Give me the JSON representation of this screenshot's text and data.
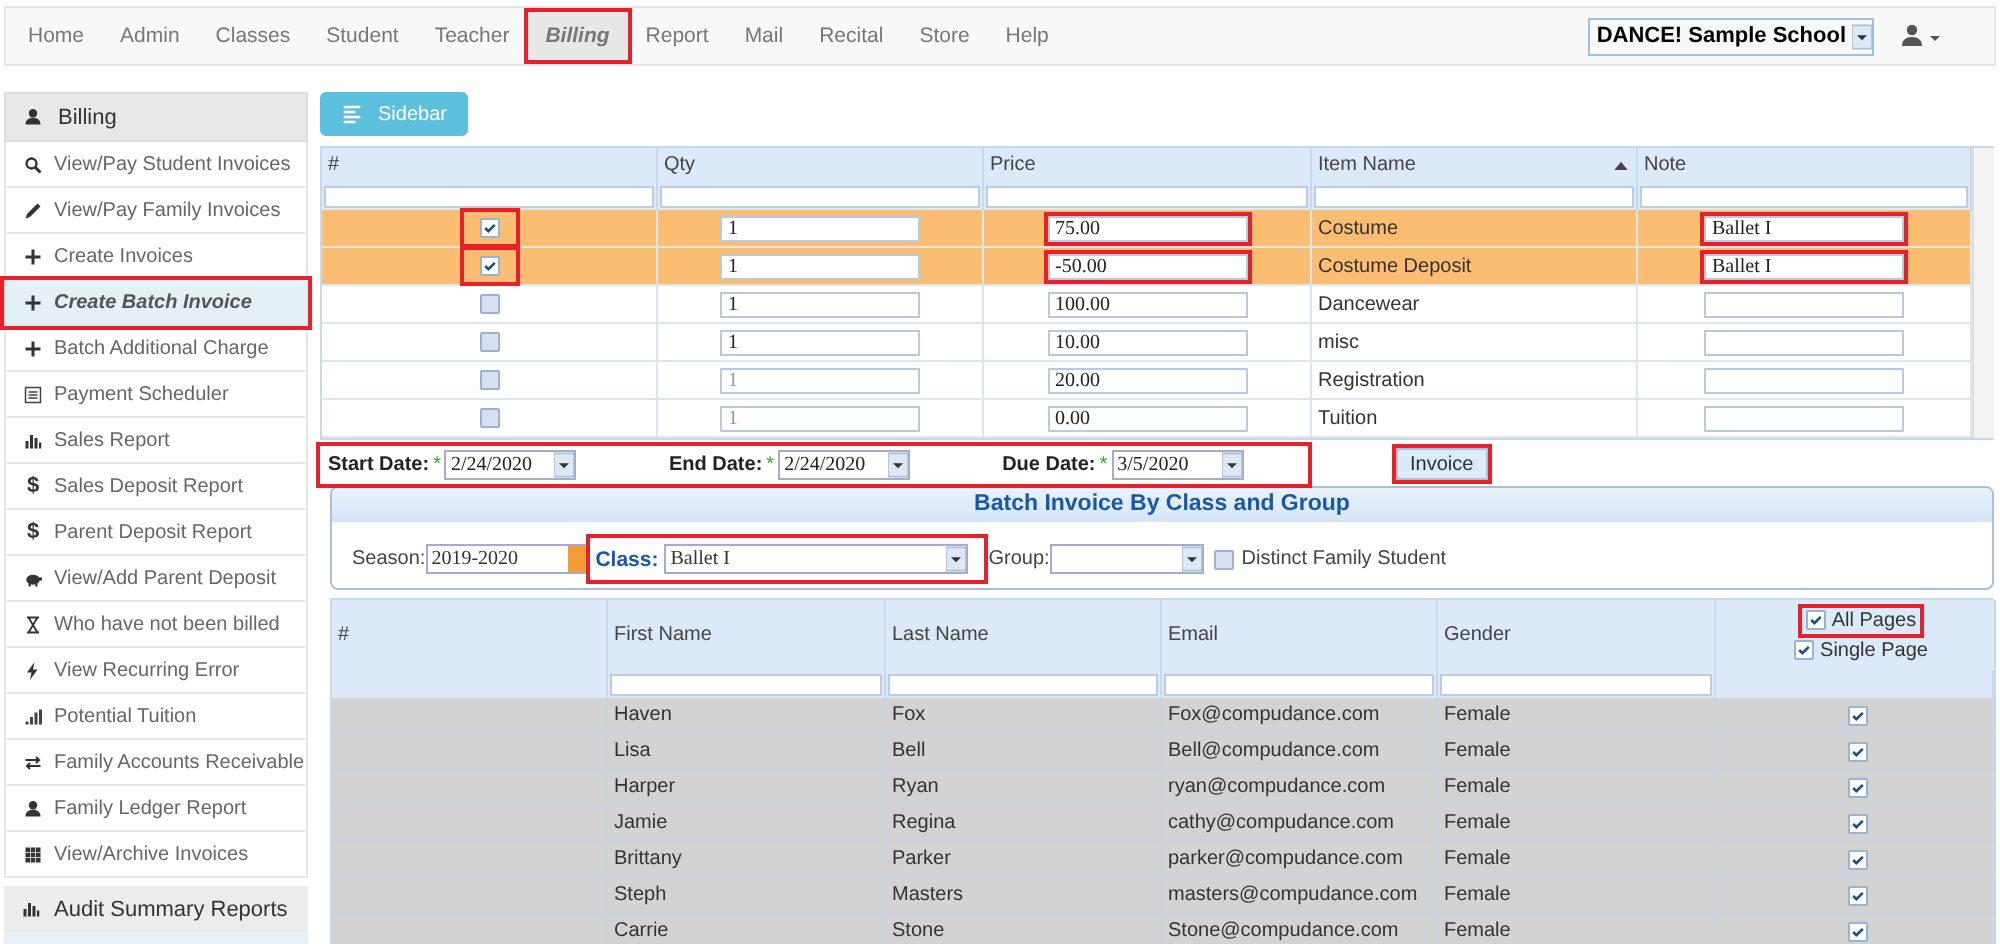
{
  "nav": {
    "items": [
      {
        "label": "Home",
        "selected": false
      },
      {
        "label": "Admin",
        "selected": false
      },
      {
        "label": "Classes",
        "selected": false
      },
      {
        "label": "Student",
        "selected": false
      },
      {
        "label": "Teacher",
        "selected": false
      },
      {
        "label": "Billing",
        "selected": true,
        "highlighted": true
      },
      {
        "label": "Report",
        "selected": false
      },
      {
        "label": "Mail",
        "selected": false
      },
      {
        "label": "Recital",
        "selected": false
      },
      {
        "label": "Store",
        "selected": false
      },
      {
        "label": "Help",
        "selected": false
      }
    ],
    "school": "DANCE! Sample School"
  },
  "sidebar": {
    "header": "Billing",
    "items": [
      {
        "label": "View/Pay Student Invoices",
        "kind": "search",
        "selected": false
      },
      {
        "label": "View/Pay Family Invoices",
        "kind": "pencil",
        "selected": false
      },
      {
        "label": "Create Invoices",
        "kind": "plus",
        "selected": false
      },
      {
        "label": "Create Batch Invoice",
        "kind": "plus",
        "selected": true,
        "highlighted": true
      },
      {
        "label": "Batch Additional Charge",
        "kind": "plus",
        "selected": false
      },
      {
        "label": "Payment Scheduler",
        "kind": "calendar",
        "selected": false
      },
      {
        "label": "Sales Report",
        "kind": "chart",
        "selected": false
      },
      {
        "label": "Sales Deposit Report",
        "kind": "glyph",
        "glyph": "$",
        "selected": false
      },
      {
        "label": "Parent Deposit Report",
        "kind": "glyph",
        "glyph": "$",
        "selected": false
      },
      {
        "label": "View/Add Parent Deposit",
        "kind": "piggy",
        "selected": false
      },
      {
        "label": "Who have not been billed",
        "kind": "hourglass",
        "selected": false
      },
      {
        "label": "View Recurring Error",
        "kind": "bolt",
        "selected": false
      },
      {
        "label": "Potential Tuition",
        "kind": "dots",
        "selected": false
      },
      {
        "label": "Family Accounts Receivable",
        "kind": "arrows",
        "selected": false
      },
      {
        "label": "Family Ledger Report",
        "kind": "user",
        "selected": false
      },
      {
        "label": "View/Archive Invoices",
        "kind": "grid",
        "selected": false
      }
    ],
    "footer": "Audit Summary Reports"
  },
  "sidebar_button": "Sidebar",
  "items_table": {
    "columns": [
      {
        "label": "#"
      },
      {
        "label": "Qty"
      },
      {
        "label": "Price"
      },
      {
        "label": "Item Name",
        "sorted": true
      },
      {
        "label": "Note"
      }
    ],
    "rows": [
      {
        "checked": true,
        "qty": "1",
        "qty_disabled": false,
        "price": "75.00",
        "item": "Costume",
        "note": "Ballet I",
        "highlighted": true
      },
      {
        "checked": true,
        "qty": "1",
        "qty_disabled": false,
        "price": "-50.00",
        "item": "Costume Deposit",
        "note": "Ballet I",
        "highlighted": true
      },
      {
        "checked": false,
        "qty": "1",
        "qty_disabled": false,
        "price": "100.00",
        "item": "Dancewear",
        "highlighted": false
      },
      {
        "checked": false,
        "qty": "1",
        "qty_disabled": false,
        "price": "10.00",
        "item": "misc",
        "highlighted": false
      },
      {
        "checked": false,
        "qty": "1",
        "qty_disabled": true,
        "price": "20.00",
        "item": "Registration",
        "highlighted": false
      },
      {
        "checked": false,
        "qty": "1",
        "qty_disabled": true,
        "price": "0.00",
        "item": "Tuition",
        "highlighted": false
      }
    ]
  },
  "dates": [
    {
      "label": "Start Date:",
      "mark": "*",
      "value": "2/24/2020"
    },
    {
      "label": "End Date:",
      "mark": "*",
      "value": "2/24/2020"
    },
    {
      "label": "Due Date:",
      "mark": "*",
      "value": "3/5/2020"
    }
  ],
  "invoice_button": "Invoice",
  "batch_panel": {
    "title": "Batch Invoice By Class and Group",
    "season": {
      "label": "Season:",
      "value": "2019-2020"
    },
    "class": {
      "label": "Class:",
      "value": "Ballet I"
    },
    "group": {
      "label": "Group:"
    },
    "distinct": {
      "label": "Distinct Family Student",
      "checked": false
    }
  },
  "students_table": {
    "columns": [
      "#",
      "First Name",
      "Last Name",
      "Email",
      "Gender"
    ],
    "page_options": [
      {
        "label": "All Pages",
        "checked": true
      },
      {
        "label": "Single Page",
        "checked": true
      }
    ],
    "rows": [
      {
        "first": "Haven",
        "last": "Fox",
        "email": "Fox@compudance.com",
        "gender": "Female",
        "checked": true
      },
      {
        "first": "Lisa",
        "last": "Bell",
        "email": "Bell@compudance.com",
        "gender": "Female",
        "checked": true
      },
      {
        "first": "Harper",
        "last": "Ryan",
        "email": "ryan@compudance.com",
        "gender": "Female",
        "checked": true
      },
      {
        "first": "Jamie",
        "last": "Regina",
        "email": "cathy@compudance.com",
        "gender": "Female",
        "checked": true
      },
      {
        "first": "Brittany",
        "last": "Parker",
        "email": "parker@compudance.com",
        "gender": "Female",
        "checked": true
      },
      {
        "first": "Steph",
        "last": "Masters",
        "email": "masters@compudance.com",
        "gender": "Female",
        "checked": true
      },
      {
        "first": "Carrie",
        "last": "Stone",
        "email": "Stone@compudance.com",
        "gender": "Female",
        "checked": true
      }
    ]
  }
}
